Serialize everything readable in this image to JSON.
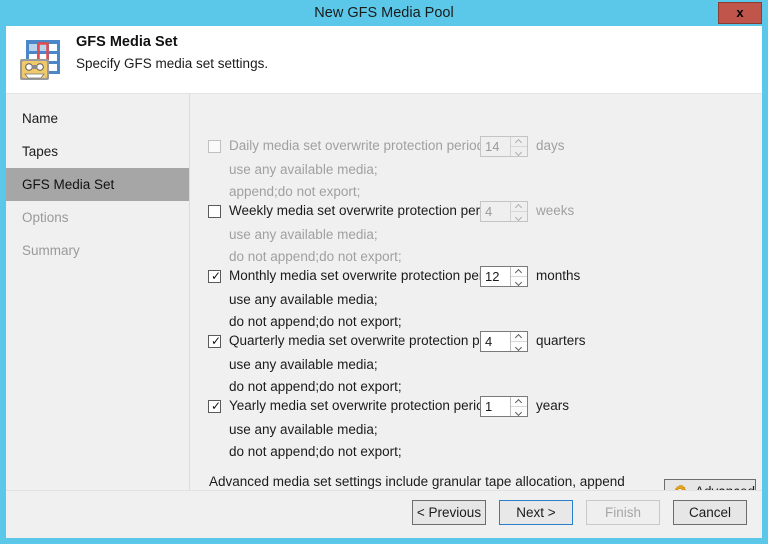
{
  "window": {
    "title": "New GFS Media Pool",
    "close_label": "x"
  },
  "header": {
    "title": "GFS Media Set",
    "subtitle": "Specify GFS media set settings.",
    "icon": "calendar-tape-icon"
  },
  "sidebar": {
    "items": [
      {
        "label": "Name",
        "state": "normal"
      },
      {
        "label": "Tapes",
        "state": "normal"
      },
      {
        "label": "GFS Media Set",
        "state": "selected"
      },
      {
        "label": "Options",
        "state": "disabled"
      },
      {
        "label": "Summary",
        "state": "disabled"
      }
    ]
  },
  "options": [
    {
      "key": "daily",
      "label": "Daily media set overwrite protection period:",
      "checked": false,
      "enabled": false,
      "value": "14",
      "unit": "days",
      "sub": [
        "use any available media;",
        "append;do not export;"
      ]
    },
    {
      "key": "weekly",
      "label": "Weekly media set overwrite protection period:",
      "checked": false,
      "enabled": true,
      "spinner_enabled": false,
      "value": "4",
      "unit": "weeks",
      "sub": [
        "use any available media;",
        "do not append;do not export;"
      ]
    },
    {
      "key": "monthly",
      "label": "Monthly media set overwrite protection period:",
      "checked": true,
      "enabled": true,
      "spinner_enabled": true,
      "value": "12",
      "unit": "months",
      "sub": [
        "use any available media;",
        "do not append;do not export;"
      ]
    },
    {
      "key": "quarterly",
      "label": "Quarterly media set overwrite protection period:",
      "checked": true,
      "enabled": true,
      "spinner_enabled": true,
      "value": "4",
      "unit": "quarters",
      "sub": [
        "use any available media;",
        "do not append;do not export;"
      ]
    },
    {
      "key": "yearly",
      "label": "Yearly media set overwrite protection period:",
      "checked": true,
      "enabled": true,
      "spinner_enabled": true,
      "value": "1",
      "unit": "years",
      "sub": [
        "use any available media;",
        "do not append;do not export;"
      ]
    }
  ],
  "advanced": {
    "description": "Advanced media set settings include granular tape allocation, append options, export options and other settings.",
    "button_label": "Advanced",
    "icon": "gear-icon"
  },
  "footer": {
    "previous_label": "< Previous",
    "next_label": "Next >",
    "finish_label": "Finish",
    "cancel_label": "Cancel"
  },
  "colors": {
    "titlebar": "#5bc8ea",
    "close_button": "#c0564b",
    "selected_nav": "#a6a6a6",
    "focus_border": "#2a7fc9",
    "gear_accent": "#e8a317",
    "icon_blue": "#4a86c8",
    "icon_red": "#e04b4b",
    "icon_tape": "#f0c96a"
  }
}
